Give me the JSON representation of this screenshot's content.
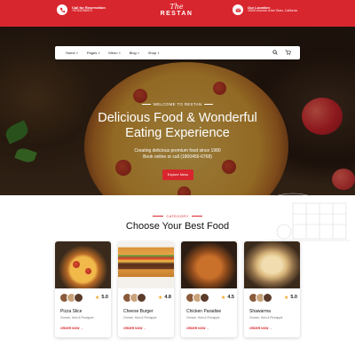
{
  "topbar": {
    "reservation_label": "Call for Reservation",
    "reservation_phone": "+97003786574",
    "location_label": "Our Location",
    "location_address": "26000 Avenue of the Stars, California",
    "brand_script": "The",
    "brand_name": "RESTAN"
  },
  "nav": {
    "items": [
      {
        "label": "Home",
        "icon": "chevron-down-icon"
      },
      {
        "label": "Pages",
        "icon": "chevron-down-icon"
      },
      {
        "label": "Menu",
        "icon": "chevron-down-icon"
      },
      {
        "label": "Blog",
        "icon": "chevron-down-icon"
      },
      {
        "label": "Shop",
        "icon": "chevron-down-icon"
      }
    ],
    "icons": [
      "search-icon",
      "cart-icon"
    ]
  },
  "hero": {
    "welcome": "WELCOME TO RESTAN",
    "title_line1": "Delicious Food & Wonderful",
    "title_line2": "Eating Experience",
    "subtitle_line1": "Creating delicious premium food since 1980",
    "subtitle_line2": "Book online or call (1800456-6768)",
    "button_label": "Explore Menu"
  },
  "category": {
    "tag": "CATEGORY",
    "title": "Choose Your Best Food",
    "cards": [
      {
        "name": "Pizza Slice",
        "desc": "Cheese, Ham & Pineapple",
        "rating": "5.0",
        "order": "ORDER NOW →"
      },
      {
        "name": "Cheese Burger",
        "desc": "Cheese, Ham & Pineapple",
        "rating": "4.8",
        "order": "ORDER NOW →"
      },
      {
        "name": "Chicken Paradise",
        "desc": "Cheese, Ham & Pineapple",
        "rating": "4.5",
        "order": "ORDER NOW →"
      },
      {
        "name": "Shawarma",
        "desc": "Cheese, Ham & Pineapple",
        "rating": "5.0",
        "order": "ORDER NOW →"
      }
    ]
  },
  "colors": {
    "accent": "#d8262e",
    "star": "#f4a623"
  }
}
